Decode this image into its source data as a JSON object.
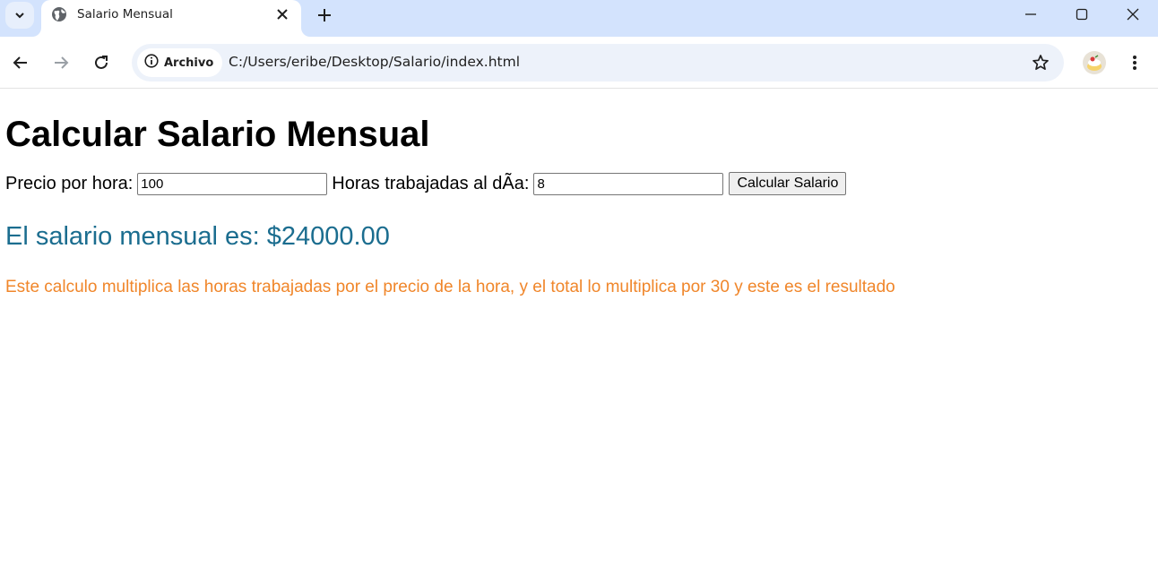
{
  "browser": {
    "tab_title": "Salario Mensual",
    "security_chip_label": "Archivo",
    "url": "C:/Users/eribe/Desktop/Salario/index.html"
  },
  "page": {
    "heading": "Calcular Salario Mensual",
    "price_label": "Precio por hora:",
    "price_value": "100",
    "hours_label": "Horas trabajadas al dÃa:",
    "hours_value": "8",
    "calc_button": "Calcular Salario",
    "result_text": "El salario mensual es: $24000.00",
    "note_text": "Este calculo multiplica las horas trabajadas por el precio de la hora, y el total lo multiplica por 30 y este es el resultado"
  },
  "colors": {
    "result_color": "#1b6d8f",
    "note_color": "#f0862a",
    "tabstrip_bg": "#d3e3fd"
  },
  "icons": [
    "tab-search-icon",
    "globe-icon",
    "close-icon",
    "plus-icon",
    "minimize-icon",
    "maximize-icon",
    "window-close-icon",
    "back-arrow-icon",
    "forward-arrow-icon",
    "reload-icon",
    "info-icon",
    "star-icon",
    "profile-avatar-icon",
    "more-vert-icon"
  ]
}
